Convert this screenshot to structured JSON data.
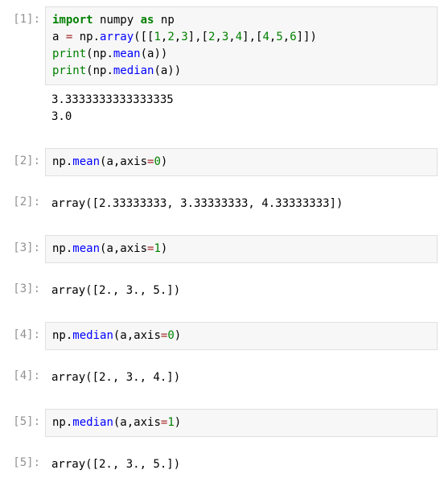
{
  "cells": [
    {
      "prompt_in": "[1]:",
      "code_tokens": [
        {
          "t": "import",
          "c": "kw"
        },
        {
          "t": " "
        },
        {
          "t": "numpy",
          "c": "nn"
        },
        {
          "t": " "
        },
        {
          "t": "as",
          "c": "kw"
        },
        {
          "t": " "
        },
        {
          "t": "np",
          "c": "nn"
        },
        {
          "t": "\n"
        },
        {
          "t": "a "
        },
        {
          "t": "=",
          "c": "op"
        },
        {
          "t": " np."
        },
        {
          "t": "array",
          "c": "func"
        },
        {
          "t": "([["
        },
        {
          "t": "1",
          "c": "num"
        },
        {
          "t": ","
        },
        {
          "t": "2",
          "c": "num"
        },
        {
          "t": ","
        },
        {
          "t": "3",
          "c": "num"
        },
        {
          "t": "],["
        },
        {
          "t": "2",
          "c": "num"
        },
        {
          "t": ","
        },
        {
          "t": "3",
          "c": "num"
        },
        {
          "t": ","
        },
        {
          "t": "4",
          "c": "num"
        },
        {
          "t": "],["
        },
        {
          "t": "4",
          "c": "num"
        },
        {
          "t": ","
        },
        {
          "t": "5",
          "c": "num"
        },
        {
          "t": ","
        },
        {
          "t": "6",
          "c": "num"
        },
        {
          "t": "]])"
        },
        {
          "t": "\n"
        },
        {
          "t": "print",
          "c": "builtin"
        },
        {
          "t": "(np."
        },
        {
          "t": "mean",
          "c": "func"
        },
        {
          "t": "(a))"
        },
        {
          "t": "\n"
        },
        {
          "t": "print",
          "c": "builtin"
        },
        {
          "t": "(np."
        },
        {
          "t": "median",
          "c": "func"
        },
        {
          "t": "(a))"
        }
      ],
      "stream_out": "3.3333333333333335\n3.0"
    },
    {
      "prompt_in": "[2]:",
      "code_tokens": [
        {
          "t": "np."
        },
        {
          "t": "mean",
          "c": "func"
        },
        {
          "t": "(a,axis"
        },
        {
          "t": "=",
          "c": "op"
        },
        {
          "t": "0",
          "c": "num"
        },
        {
          "t": ")"
        }
      ],
      "prompt_out": "[2]:",
      "exec_out": "array([2.33333333, 3.33333333, 4.33333333])"
    },
    {
      "prompt_in": "[3]:",
      "code_tokens": [
        {
          "t": "np."
        },
        {
          "t": "mean",
          "c": "func"
        },
        {
          "t": "(a,axis"
        },
        {
          "t": "=",
          "c": "op"
        },
        {
          "t": "1",
          "c": "num"
        },
        {
          "t": ")"
        }
      ],
      "prompt_out": "[3]:",
      "exec_out": "array([2., 3., 5.])"
    },
    {
      "prompt_in": "[4]:",
      "code_tokens": [
        {
          "t": "np."
        },
        {
          "t": "median",
          "c": "func"
        },
        {
          "t": "(a,axis"
        },
        {
          "t": "=",
          "c": "op"
        },
        {
          "t": "0",
          "c": "num"
        },
        {
          "t": ")"
        }
      ],
      "prompt_out": "[4]:",
      "exec_out": "array([2., 3., 4.])"
    },
    {
      "prompt_in": "[5]:",
      "code_tokens": [
        {
          "t": "np."
        },
        {
          "t": "median",
          "c": "func"
        },
        {
          "t": "(a,axis"
        },
        {
          "t": "=",
          "c": "op"
        },
        {
          "t": "1",
          "c": "num"
        },
        {
          "t": ")"
        }
      ],
      "prompt_out": "[5]:",
      "exec_out": "array([2., 3., 5.])"
    }
  ]
}
